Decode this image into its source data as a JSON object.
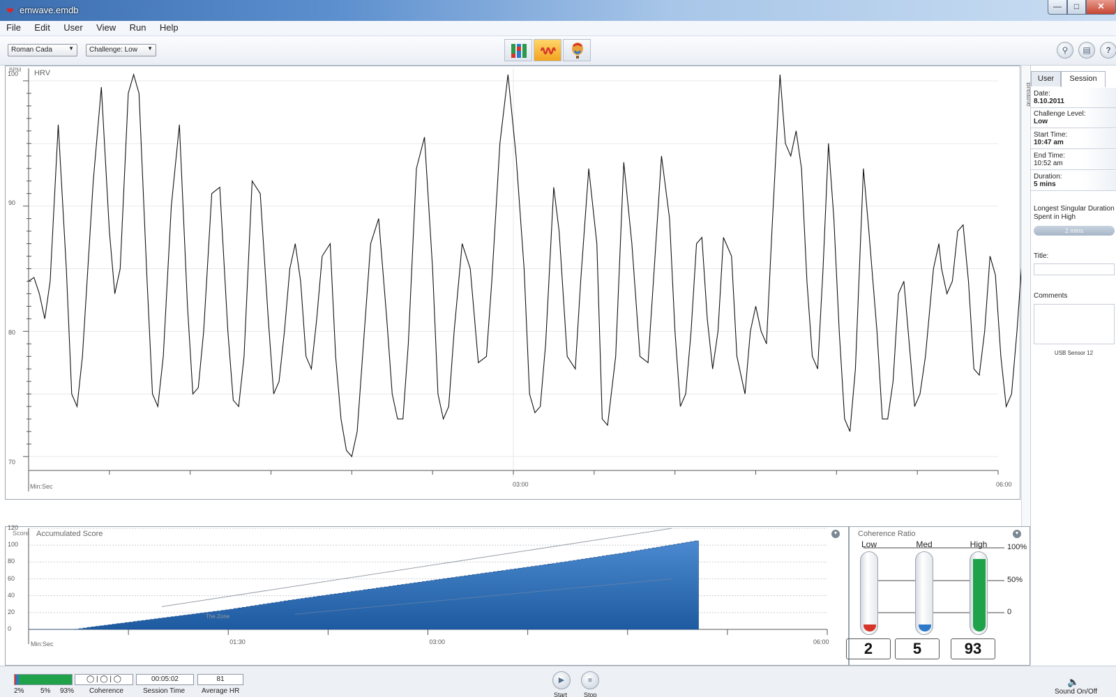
{
  "window": {
    "title": "emwave.emdb",
    "min": "—",
    "max": "□",
    "close": "✕"
  },
  "menu": [
    "File",
    "Edit",
    "User",
    "View",
    "Run",
    "Help"
  ],
  "toolbar": {
    "user": "Roman Cada",
    "challenge": "Challenge: Low",
    "modes": [
      "bar-chart-icon",
      "hrv-wave-icon",
      "balloon-icon"
    ],
    "right_icons": [
      "search-icon",
      "book-icon",
      "help-icon"
    ]
  },
  "hrv": {
    "title": "HRV",
    "unit": "BPM",
    "xlabel": "Min:Sec",
    "yticks": [
      "100",
      "90",
      "80",
      "70"
    ],
    "xticks": [
      "03:00",
      "06:00"
    ]
  },
  "breathe_label": "Breathe",
  "session": {
    "tabs": {
      "user": "User",
      "session": "Session"
    },
    "date_label": "Date:",
    "date": "8.10.2011",
    "challenge_label": "Challenge Level:",
    "challenge": "Low",
    "start_label": "Start Time:",
    "start": "10:47 am",
    "end_label": "End Time:",
    "end": "10:52 am",
    "duration_label": "Duration:",
    "duration": "5 mins",
    "longest_label": "Longest Singular Duration Spent in High",
    "longest": "2 mins",
    "title_label": "Title:",
    "comments_label": "Comments",
    "sensor": "USB Sensor 12"
  },
  "score": {
    "title": "Accumulated Score",
    "ylabel": "Score",
    "xlabel": "Min:Sec",
    "yticks": [
      "120",
      "100",
      "80",
      "60",
      "40",
      "20",
      "0"
    ],
    "xticks": [
      "01:30",
      "03:00",
      "06:00"
    ],
    "zone_label": "The Zone"
  },
  "coherence": {
    "title": "Coherence Ratio",
    "labels": [
      "Low",
      "Med",
      "High"
    ],
    "values": [
      "2",
      "5",
      "93"
    ],
    "pcts": [
      "100%",
      "50%",
      "0"
    ],
    "colors": [
      "#d8352a",
      "#2f79c9",
      "#1fa24a"
    ]
  },
  "status": {
    "pct_low": "2%",
    "pct_med": "5%",
    "pct_high": "93%",
    "coherence_label": "Coherence",
    "session_time": "00:05:02",
    "session_time_label": "Session Time",
    "avg_hr": "81",
    "avg_hr_label": "Average HR",
    "start_label": "Start",
    "stop_label": "Stop",
    "sound_label": "Sound On/Off"
  },
  "chart_data": [
    {
      "type": "line",
      "title": "HRV",
      "ylabel": "BPM",
      "xlabel": "Min:Sec",
      "ylim": [
        69,
        101
      ],
      "xlim": [
        0,
        360
      ],
      "series": [
        {
          "values": [
            [
              0,
              84
            ],
            [
              2,
              84.3
            ],
            [
              4,
              83
            ],
            [
              6,
              81
            ],
            [
              8,
              84
            ],
            [
              11,
              96.5
            ],
            [
              14,
              85
            ],
            [
              16,
              75
            ],
            [
              18,
              74
            ],
            [
              20,
              78
            ],
            [
              24,
              92
            ],
            [
              27,
              99.5
            ],
            [
              30,
              88
            ],
            [
              32,
              83
            ],
            [
              34,
              85
            ],
            [
              37,
              99
            ],
            [
              39,
              100.5
            ],
            [
              41,
              99
            ],
            [
              44,
              84
            ],
            [
              46,
              75
            ],
            [
              48,
              74
            ],
            [
              50,
              78
            ],
            [
              53,
              90
            ],
            [
              56,
              96.5
            ],
            [
              59,
              82
            ],
            [
              61,
              75
            ],
            [
              63,
              75.5
            ],
            [
              65,
              80
            ],
            [
              68,
              91
            ],
            [
              71,
              91.5
            ],
            [
              74,
              80
            ],
            [
              76,
              74.5
            ],
            [
              78,
              74
            ],
            [
              80,
              78
            ],
            [
              83,
              92
            ],
            [
              86,
              91
            ],
            [
              89,
              81
            ],
            [
              91,
              75
            ],
            [
              93,
              76
            ],
            [
              95,
              80
            ],
            [
              97,
              85
            ],
            [
              99,
              87
            ],
            [
              101,
              84
            ],
            [
              103,
              78
            ],
            [
              105,
              77
            ],
            [
              107,
              81
            ],
            [
              109,
              86
            ],
            [
              112,
              87
            ],
            [
              114,
              78
            ],
            [
              116,
              73
            ],
            [
              118,
              70.5
            ],
            [
              120,
              70
            ],
            [
              122,
              72
            ],
            [
              124,
              78
            ],
            [
              127,
              87
            ],
            [
              130,
              89
            ],
            [
              133,
              81
            ],
            [
              135,
              75
            ],
            [
              137,
              73
            ],
            [
              139,
              73
            ],
            [
              141,
              79
            ],
            [
              144,
              93
            ],
            [
              147,
              95.5
            ],
            [
              150,
              85
            ],
            [
              152,
              75
            ],
            [
              154,
              73
            ],
            [
              156,
              74
            ],
            [
              158,
              80
            ],
            [
              161,
              87
            ],
            [
              164,
              85
            ],
            [
              167,
              77.5
            ],
            [
              170,
              78
            ],
            [
              172,
              84
            ],
            [
              175,
              95
            ],
            [
              178,
              100.5
            ],
            [
              181,
              94
            ],
            [
              184,
              85
            ],
            [
              186,
              75
            ],
            [
              188,
              73.5
            ],
            [
              190,
              74
            ],
            [
              192,
              79
            ],
            [
              195,
              91.5
            ],
            [
              197,
              88
            ],
            [
              200,
              78
            ],
            [
              203,
              77
            ],
            [
              205,
              84
            ],
            [
              208,
              93
            ],
            [
              211,
              87
            ],
            [
              213,
              73
            ],
            [
              215,
              72.5
            ],
            [
              218,
              78
            ],
            [
              221,
              93.5
            ],
            [
              224,
              87
            ],
            [
              227,
              78
            ],
            [
              230,
              77.5
            ],
            [
              232,
              84
            ],
            [
              235,
              94
            ],
            [
              238,
              89
            ],
            [
              240,
              80
            ],
            [
              242,
              74
            ],
            [
              244,
              75
            ],
            [
              246,
              80
            ],
            [
              248,
              87
            ],
            [
              250,
              87.5
            ],
            [
              252,
              81
            ],
            [
              254,
              77
            ],
            [
              256,
              80
            ],
            [
              258,
              87.5
            ],
            [
              261,
              86
            ],
            [
              263,
              78
            ],
            [
              266,
              75
            ],
            [
              268,
              80
            ],
            [
              270,
              82
            ],
            [
              272,
              80
            ],
            [
              274,
              79
            ],
            [
              276,
              88
            ],
            [
              279,
              100.5
            ],
            [
              281,
              95
            ],
            [
              283,
              94
            ],
            [
              285,
              96
            ],
            [
              287,
              93
            ],
            [
              289,
              84
            ],
            [
              291,
              78
            ],
            [
              293,
              77
            ],
            [
              295,
              85
            ],
            [
              297,
              95
            ],
            [
              299,
              89
            ],
            [
              301,
              80
            ],
            [
              303,
              73
            ],
            [
              305,
              72
            ],
            [
              307,
              77
            ],
            [
              310,
              93
            ],
            [
              312,
              88
            ],
            [
              315,
              80
            ],
            [
              317,
              73
            ],
            [
              319,
              73
            ],
            [
              321,
              76
            ],
            [
              323,
              83
            ],
            [
              325,
              84
            ],
            [
              327,
              79
            ],
            [
              329,
              74
            ],
            [
              331,
              75
            ],
            [
              333,
              78
            ],
            [
              336,
              85
            ],
            [
              338,
              87
            ],
            [
              339,
              85
            ],
            [
              341,
              83
            ],
            [
              343,
              84
            ],
            [
              345,
              88
            ],
            [
              347,
              88.5
            ],
            [
              349,
              84
            ],
            [
              351,
              77
            ],
            [
              353,
              76.5
            ],
            [
              355,
              80
            ],
            [
              357,
              86
            ],
            [
              359,
              84.5
            ],
            [
              361,
              78
            ],
            [
              363,
              74
            ],
            [
              365,
              75
            ],
            [
              367,
              80
            ],
            [
              369,
              86
            ],
            [
              371,
              83
            ],
            [
              373,
              77
            ],
            [
              375,
              74
            ],
            [
              377,
              74.5
            ],
            [
              379,
              80
            ],
            [
              381,
              86.5
            ],
            [
              384,
              84
            ],
            [
              386,
              77
            ],
            [
              388,
              74
            ],
            [
              390,
              73
            ],
            [
              392,
              76
            ],
            [
              394,
              83
            ],
            [
              396,
              86
            ],
            [
              398,
              81
            ],
            [
              400,
              75
            ],
            [
              402,
              74.5
            ],
            [
              404,
              79
            ],
            [
              406,
              86
            ],
            [
              408,
              84
            ],
            [
              410,
              77
            ],
            [
              412,
              73.5
            ],
            [
              414,
              73
            ],
            [
              416,
              78
            ],
            [
              418,
              85
            ],
            [
              420,
              86
            ],
            [
              422,
              81
            ],
            [
              424,
              75
            ],
            [
              426,
              73
            ],
            [
              428,
              74
            ],
            [
              430,
              79
            ],
            [
              432,
              88
            ],
            [
              434,
              89.5
            ],
            [
              436,
              87
            ],
            [
              438,
              97
            ],
            [
              440,
              100.5
            ],
            [
              442,
              93
            ],
            [
              444,
              90
            ],
            [
              446,
              88
            ],
            [
              448,
              95
            ],
            [
              450,
              93
            ],
            [
              452,
              87.5
            ],
            [
              454,
              84
            ],
            [
              456,
              90
            ],
            [
              458,
              100.5
            ],
            [
              460,
              95
            ],
            [
              462,
              87
            ],
            [
              464,
              80
            ],
            [
              466,
              77
            ],
            [
              468,
              76.5
            ],
            [
              470,
              78
            ],
            [
              472,
              88
            ],
            [
              474,
              95
            ],
            [
              476,
              86
            ],
            [
              477,
              80
            ],
            [
              478,
              76
            ],
            [
              479,
              69
            ],
            [
              480,
              70
            ],
            [
              481,
              76
            ],
            [
              483,
              81
            ],
            [
              485,
              85
            ],
            [
              487,
              75
            ],
            [
              489,
              73
            ],
            [
              491,
              73.5
            ],
            [
              493,
              78
            ],
            [
              495,
              86
            ],
            [
              497,
              87
            ],
            [
              499,
              84.5
            ],
            [
              501,
              83.5
            ]
          ]
        }
      ]
    },
    {
      "type": "area",
      "title": "Accumulated Score",
      "ylabel": "Score",
      "xlabel": "Min:Sec",
      "ylim": [
        0,
        120
      ],
      "xlim": [
        0,
        360
      ],
      "x": [
        0,
        22,
        30,
        60,
        90,
        120,
        150,
        180,
        210,
        240,
        270,
        302
      ],
      "series": [
        {
          "values": [
            0,
            0,
            3,
            13,
            23,
            35,
            46,
            57,
            68,
            79,
            91,
            105
          ]
        }
      ]
    },
    {
      "type": "bar",
      "title": "Coherence Ratio",
      "categories": [
        "Low",
        "Med",
        "High"
      ],
      "values": [
        2,
        5,
        93
      ],
      "ylim": [
        0,
        100
      ]
    }
  ]
}
